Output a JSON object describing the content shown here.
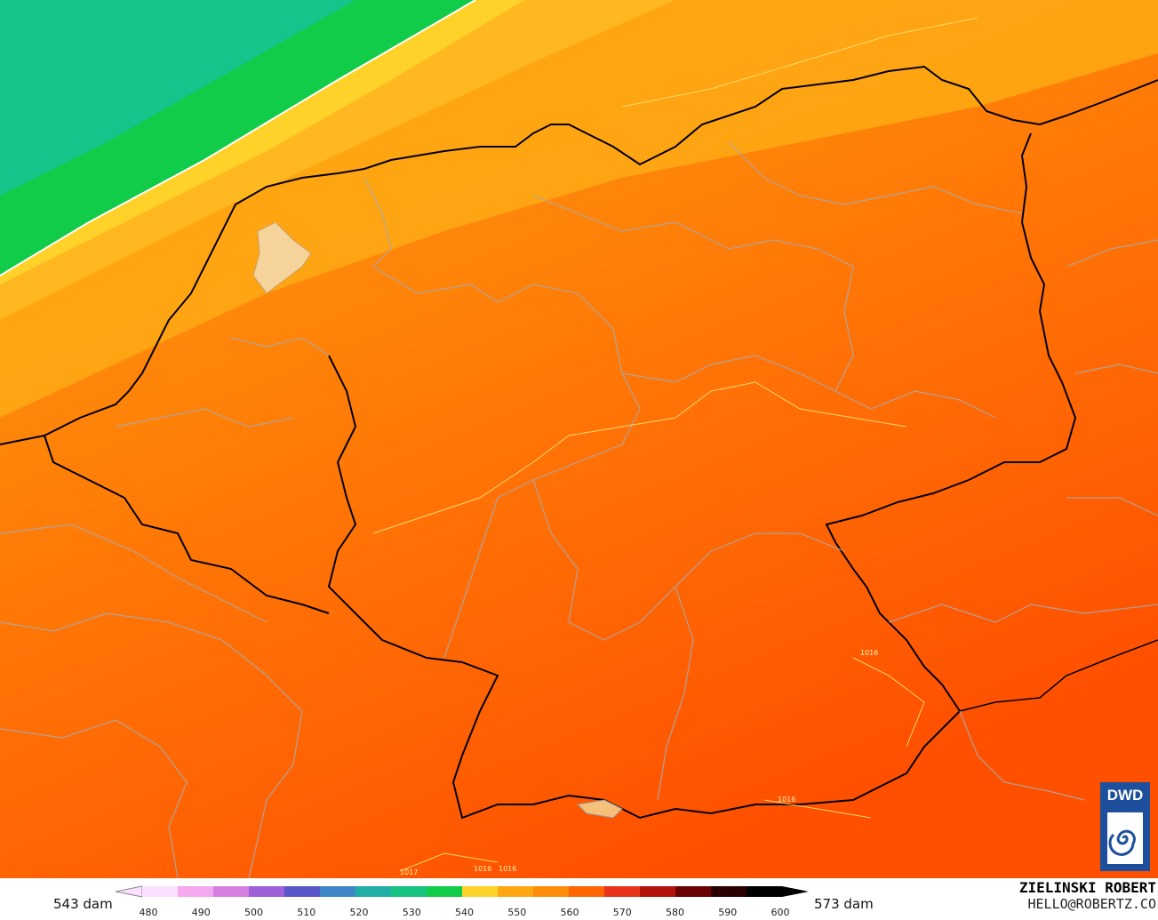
{
  "map": {
    "region": "Central Europe",
    "field": "500 hPa geopotential height",
    "band_colors": [
      "#14c48a",
      "#10cc48",
      "#ffd22a",
      "#ffa713",
      "#ff8d0a",
      "#ff7a06",
      "#ff6503",
      "#ff5202"
    ],
    "isobar_labels": [
      "1016",
      "1016",
      "1016",
      "1016",
      "1017"
    ]
  },
  "legend": {
    "left_label": "543 dam",
    "right_label": "573 dam",
    "ticks": [
      "480",
      "490",
      "500",
      "510",
      "520",
      "530",
      "540",
      "550",
      "560",
      "570",
      "580",
      "590",
      "600"
    ],
    "colors": [
      "#fce0ff",
      "#f4a8f0",
      "#d67fe0",
      "#9d60d8",
      "#5a58c8",
      "#3d86c8",
      "#22aea6",
      "#16c280",
      "#10cc48",
      "#ffd22a",
      "#ffa713",
      "#ff8d0a",
      "#ff6503",
      "#e8341b",
      "#b3140c",
      "#6a0404",
      "#2a0000",
      "#000000"
    ]
  },
  "credits": {
    "author": "ZIELINSKI ROBERT",
    "email": "HELLO@ROBERTZ.CO"
  },
  "logo": {
    "text": "DWD"
  }
}
